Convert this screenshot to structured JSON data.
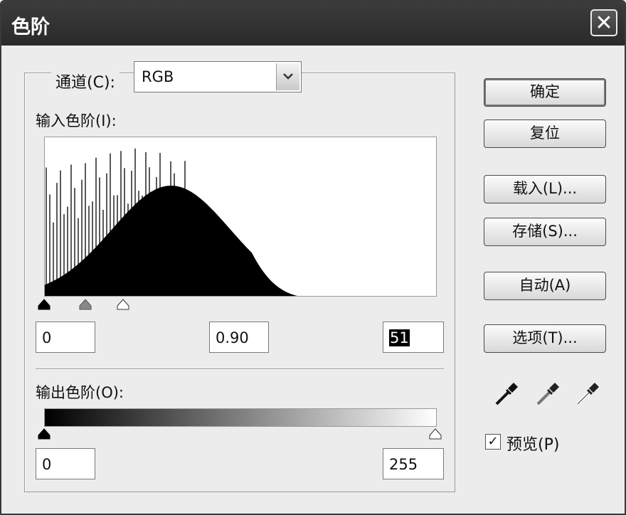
{
  "window": {
    "title": "色阶",
    "close_symbol": "✕"
  },
  "channel": {
    "label": "通道(C):",
    "value": "RGB",
    "dropdown_icon": "chevron-down-icon"
  },
  "input_levels": {
    "label": "输入色阶(I):",
    "black": "0",
    "gamma": "0.90",
    "white": "51"
  },
  "output_levels": {
    "label": "输出色阶(O):",
    "black": "0",
    "white": "255"
  },
  "buttons": {
    "ok": "确定",
    "reset": "复位",
    "load": "载入(L)...",
    "save": "存储(S)...",
    "auto": "自动(A)",
    "options": "选项(T)..."
  },
  "preview": {
    "label": "预览(P)",
    "checked": true,
    "check_mark": "✓"
  },
  "icons": [
    "black-eyedropper-icon",
    "gray-eyedropper-icon",
    "white-eyedropper-icon"
  ]
}
